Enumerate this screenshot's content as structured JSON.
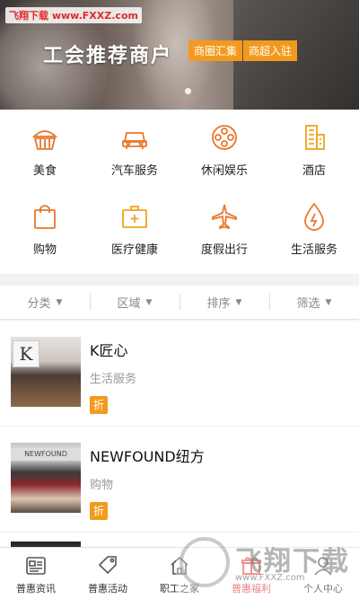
{
  "watermark": {
    "top": "飞翔下载 www.FXXZ.com",
    "brand": "飞翔下载",
    "url": "www.FXXZ.com"
  },
  "banner": {
    "title": "工会推荐商户",
    "tags": [
      "商圈汇集",
      "商超入驻"
    ]
  },
  "categories": [
    {
      "label": "美食",
      "icon": "cake-icon"
    },
    {
      "label": "汽车服务",
      "icon": "car-icon"
    },
    {
      "label": "休闲娱乐",
      "icon": "film-reel-icon"
    },
    {
      "label": "酒店",
      "icon": "building-icon"
    },
    {
      "label": "购物",
      "icon": "shopping-bag-icon"
    },
    {
      "label": "医疗健康",
      "icon": "medical-kit-icon"
    },
    {
      "label": "度假出行",
      "icon": "airplane-icon"
    },
    {
      "label": "生活服务",
      "icon": "lightning-drop-icon"
    }
  ],
  "filters": [
    "分类",
    "区域",
    "排序",
    "筛选"
  ],
  "merchants": [
    {
      "name": "K匠心",
      "type": "生活服务",
      "badge": "折"
    },
    {
      "name": "NEWFOUND纽方",
      "type": "购物",
      "badge": "折"
    }
  ],
  "thumb_text": {
    "k_sign": "K",
    "newfound_sign": "NEWFOUND"
  },
  "tabs": [
    {
      "label": "普惠资讯",
      "icon": "news-icon"
    },
    {
      "label": "普惠活动",
      "icon": "tag-icon"
    },
    {
      "label": "职工之家",
      "icon": "home-icon"
    },
    {
      "label": "普惠福利",
      "icon": "gift-icon"
    },
    {
      "label": "个人中心",
      "icon": "person-icon"
    }
  ],
  "colors": {
    "accent": "#f39a1e",
    "icon_orange": "#e8772c",
    "active_tab": "#e23b3b"
  }
}
